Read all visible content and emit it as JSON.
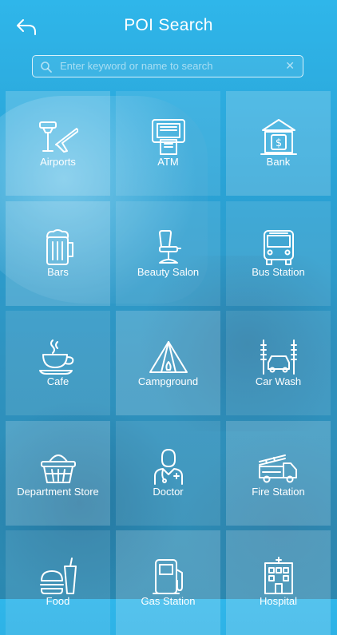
{
  "header": {
    "title": "POI Search"
  },
  "search": {
    "placeholder": "Enter keyword or name to search"
  },
  "categories": [
    {
      "label": "Airports",
      "icon": "airport-icon"
    },
    {
      "label": "ATM",
      "icon": "atm-icon"
    },
    {
      "label": "Bank",
      "icon": "bank-icon"
    },
    {
      "label": "Bars",
      "icon": "beer-mug-icon"
    },
    {
      "label": "Beauty Salon",
      "icon": "salon-chair-icon"
    },
    {
      "label": "Bus Station",
      "icon": "bus-icon"
    },
    {
      "label": "Cafe",
      "icon": "coffee-cup-icon"
    },
    {
      "label": "Campground",
      "icon": "tent-icon"
    },
    {
      "label": "Car Wash",
      "icon": "car-wash-icon"
    },
    {
      "label": "Department Store",
      "icon": "shopping-basket-icon"
    },
    {
      "label": "Doctor",
      "icon": "doctor-icon"
    },
    {
      "label": "Fire Station",
      "icon": "fire-truck-icon"
    },
    {
      "label": "Food",
      "icon": "fast-food-icon"
    },
    {
      "label": "Gas Station",
      "icon": "fuel-pump-icon"
    },
    {
      "label": "Hospital",
      "icon": "hospital-icon"
    }
  ]
}
